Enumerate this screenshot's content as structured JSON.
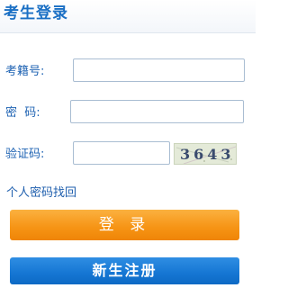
{
  "header": {
    "title": "考生登录"
  },
  "form": {
    "exam_id_label": "考籍号:",
    "exam_id_value": "",
    "password_label": "密  码:",
    "password_value": "",
    "captcha_label": "验证码:",
    "captcha_value": "",
    "captcha_code": "3643"
  },
  "links": {
    "recover_password": "个人密码找回"
  },
  "buttons": {
    "login": "登 录",
    "register": "新生注册"
  },
  "colors": {
    "title": "#1a6fc4",
    "label": "#1f63b3",
    "login_button": "#f69314",
    "register_button": "#1576d3"
  }
}
